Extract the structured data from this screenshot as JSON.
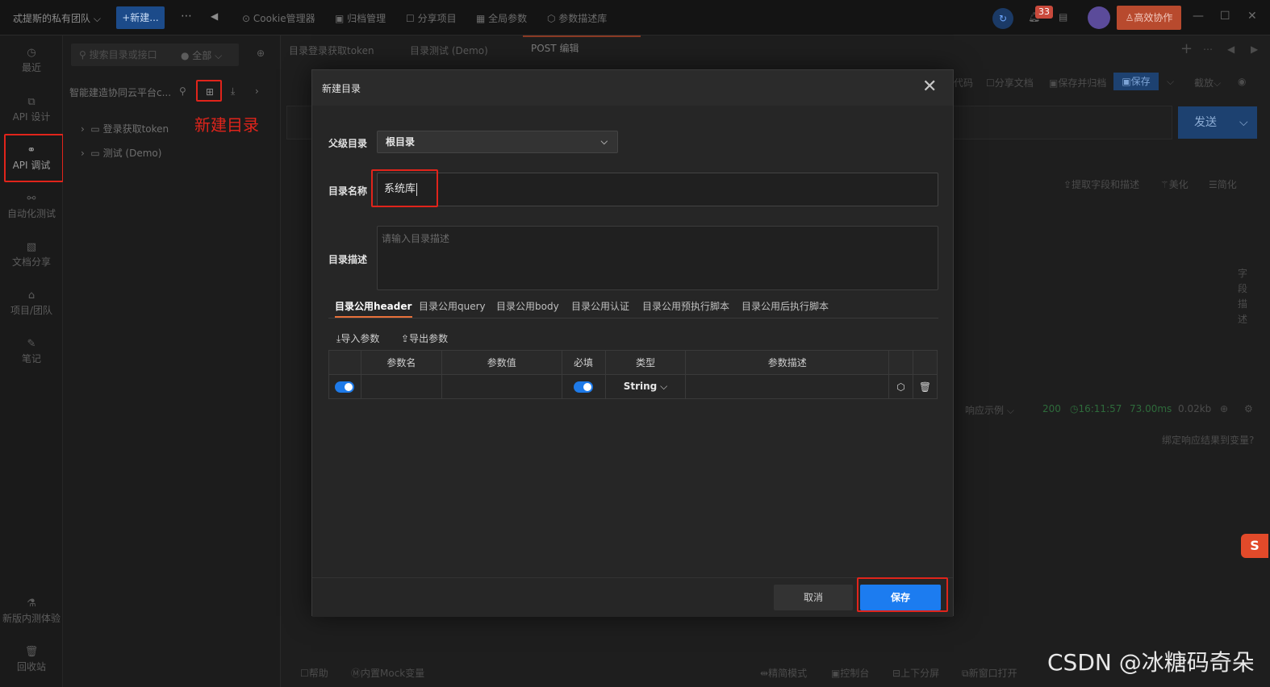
{
  "topbar": {
    "team": "忒提斯的私有团队 ⌵",
    "new_button": "+新建...",
    "nav": [
      "Cookie管理器",
      "归档管理",
      "分享项目",
      "全局参数",
      "参数描述库"
    ],
    "badge_count": "33",
    "collab_button": "高效协作"
  },
  "rail": {
    "items": [
      "最近",
      "API 设计",
      "API 调试",
      "自动化测试",
      "文档分享",
      "项目/团队",
      "笔记"
    ],
    "bottom": [
      "新版内测体验",
      "回收站"
    ]
  },
  "sidepanel": {
    "search_placeholder": "搜索目录或接口",
    "filter": "● 全部",
    "project": "智能建造协同云平台c...",
    "annotation": "新建目录",
    "tree": [
      "登录获取token",
      "测试 (Demo)"
    ]
  },
  "main": {
    "tabs": [
      "目录登录获取token",
      "目录测试 (Demo)",
      "POST 编辑"
    ],
    "toolbar": [
      "代码",
      "分享文档",
      "保存并归档"
    ],
    "save_label": "保存",
    "view_label": "截放",
    "send_label": "发送",
    "resp_tools": [
      "提取字段和描述",
      "美化",
      "简化"
    ],
    "status": "200",
    "time": "16:11:57",
    "duration": "73.00ms",
    "size": "0.02kb",
    "resp_example": "响应示例",
    "bind_link": "绑定响应结果到变量?",
    "vertical_label": "字段描述",
    "footer": [
      "帮助",
      "内置Mock变量",
      "精简模式",
      "控制台",
      "上下分屏",
      "新窗口打开"
    ],
    "watermark": "CSDN @冰糖码奇朵",
    "sogou": "S"
  },
  "modal": {
    "title": "新建目录",
    "parent_label": "父级目录",
    "parent_value": "根目录",
    "name_label": "目录名称",
    "name_value": "系统库",
    "desc_label": "目录描述",
    "desc_placeholder": "请输入目录描述",
    "tabs": [
      "目录公用header",
      "目录公用query",
      "目录公用body",
      "目录公用认证",
      "目录公用预执行脚本",
      "目录公用后执行脚本"
    ],
    "import_label": "导入参数",
    "export_label": "导出参数",
    "columns": [
      "参数名",
      "参数值",
      "必填",
      "类型",
      "参数描述"
    ],
    "row": {
      "type": "String"
    },
    "cancel_label": "取消",
    "save_label": "保存"
  }
}
